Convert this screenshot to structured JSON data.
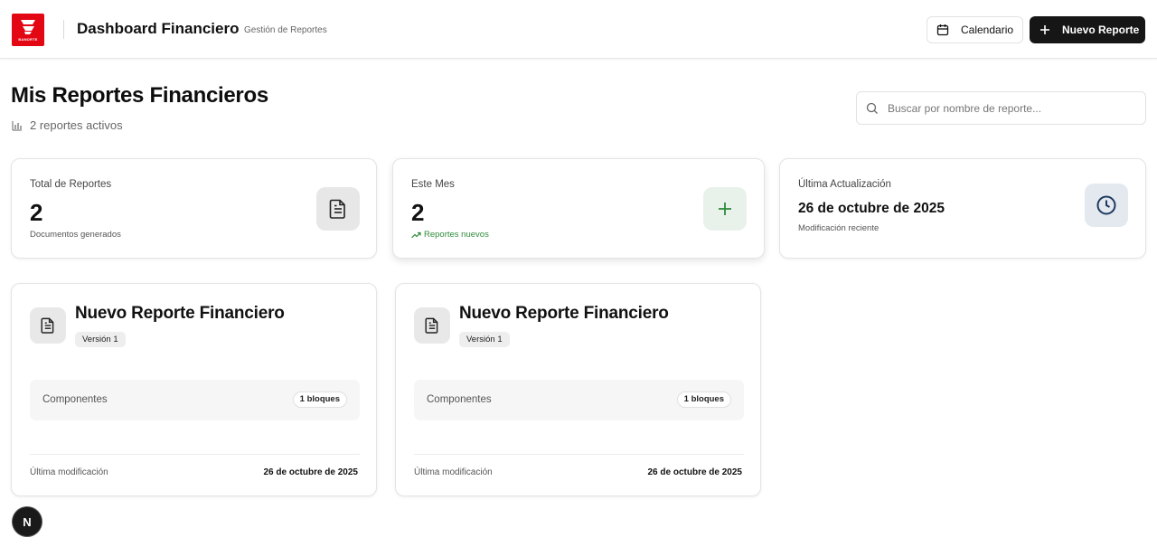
{
  "brand": {
    "logo_text": "BANORTE",
    "accent": "#e30613"
  },
  "header": {
    "title": "Dashboard Financiero",
    "subtitle": "Gestión de Reportes",
    "calendar_label": "Calendario",
    "new_report_label": "Nuevo Reporte"
  },
  "page": {
    "title": "Mis Reportes Financieros",
    "active_count": "2 reportes activos"
  },
  "search": {
    "placeholder": "Buscar por nombre de reporte...",
    "value": ""
  },
  "stats": [
    {
      "label": "Total de Reportes",
      "value": "2",
      "note": "Documentos generados",
      "icon": "document-icon"
    },
    {
      "label": "Este Mes",
      "value": "2",
      "note": "Reportes nuevos",
      "icon": "plus-icon",
      "note_color": "#2e8b3a"
    },
    {
      "label": "Última Actualización",
      "value": "26 de octubre de 2025",
      "note": "Modificación reciente",
      "icon": "clock-icon"
    }
  ],
  "reports": [
    {
      "title": "Nuevo Reporte Financiero",
      "version": "Versión 1",
      "components_label": "Componentes",
      "components_count": "1 bloques",
      "modified_label": "Última modificación",
      "modified_value": "26 de octubre de 2025"
    },
    {
      "title": "Nuevo Reporte Financiero",
      "version": "Versión 1",
      "components_label": "Componentes",
      "components_count": "1 bloques",
      "modified_label": "Última modificación",
      "modified_value": "26 de octubre de 2025"
    }
  ],
  "dev_badge": "N"
}
